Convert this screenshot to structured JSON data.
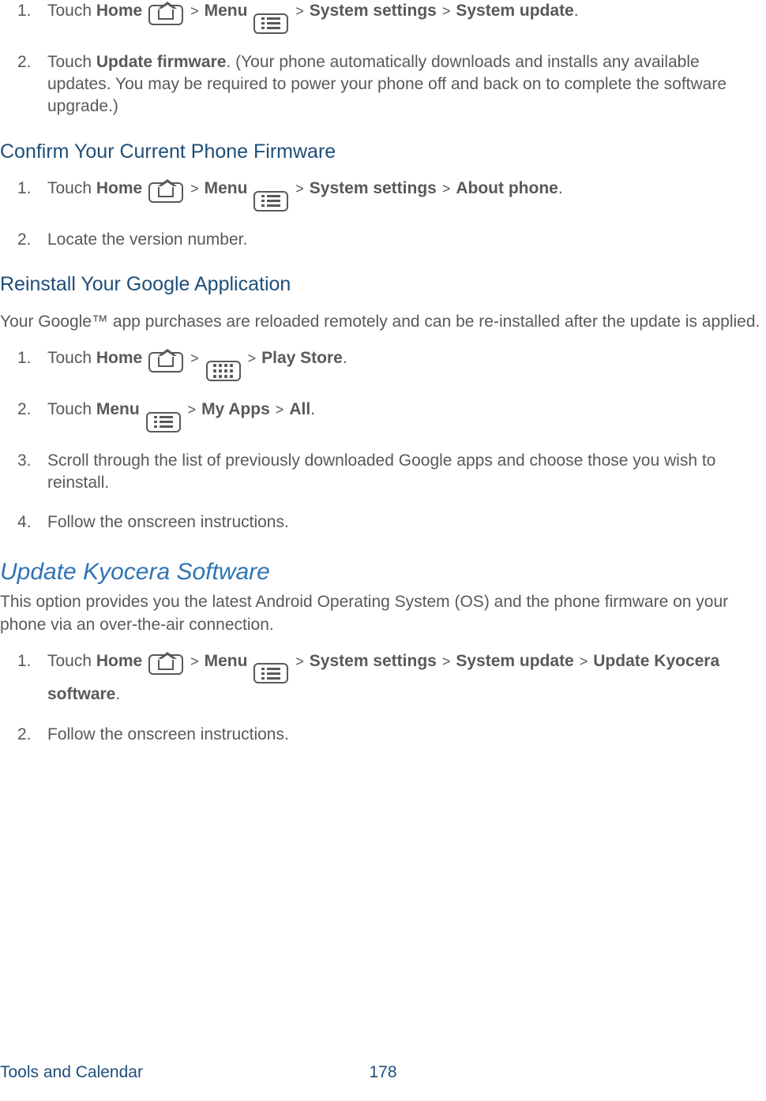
{
  "list1": {
    "items": [
      {
        "num": "1.",
        "pre": "Touch ",
        "b1": "Home",
        "sep1": " > ",
        "b2": "Menu",
        "sep2": " > ",
        "b3": "System settings",
        "sep3": " > ",
        "b4": "System update",
        "post": "."
      },
      {
        "num": "2.",
        "pre": "Touch ",
        "b1": "Update firmware",
        "post": ". (Your phone automatically downloads and installs any available updates. You may be required to power your phone off and back on to complete the software upgrade.)"
      }
    ]
  },
  "h3_1": "Confirm Your Current Phone Firmware",
  "list2": {
    "items": [
      {
        "num": "1.",
        "pre": "Touch ",
        "b1": "Home",
        "sep1": " > ",
        "b2": "Menu",
        "sep2": " > ",
        "b3": "System settings",
        "sep3": " > ",
        "b4": "About phone",
        "post": "."
      },
      {
        "num": "2.",
        "text": "Locate the version number."
      }
    ]
  },
  "h3_2": "Reinstall Your Google Application",
  "para1": "Your Google™ app purchases are reloaded remotely and can be re-installed after the update is applied.",
  "list3": {
    "items": [
      {
        "num": "1.",
        "pre": "Touch ",
        "b1": "Home",
        "sep1": " > ",
        "sep2": " > ",
        "b2": "Play Store",
        "post": "."
      },
      {
        "num": "2.",
        "pre": "Touch ",
        "b1": "Menu",
        "sep1": " > ",
        "b2": "My Apps",
        "sep2": " > ",
        "b3": "All",
        "post": "."
      },
      {
        "num": "3.",
        "text": "Scroll through the list of previously downloaded Google apps and choose those you wish to reinstall."
      },
      {
        "num": "4.",
        "text": "Follow the onscreen instructions."
      }
    ]
  },
  "h2": "Update Kyocera Software",
  "para2": "This option provides you the latest Android Operating System (OS) and the phone firmware on your phone via an over-the-air connection.",
  "list4": {
    "items": [
      {
        "num": "1.",
        "pre": "Touch ",
        "b1": "Home",
        "sep1": " > ",
        "b2": "Menu",
        "sep2": " > ",
        "b3": "System settings",
        "sep3": " > ",
        "b4": "System update",
        "sep4": " > ",
        "b5": "Update Kyocera software",
        "post": "."
      },
      {
        "num": "2.",
        "text": "Follow the onscreen instructions."
      }
    ]
  },
  "footer": {
    "left": "Tools and Calendar",
    "page": "178"
  }
}
